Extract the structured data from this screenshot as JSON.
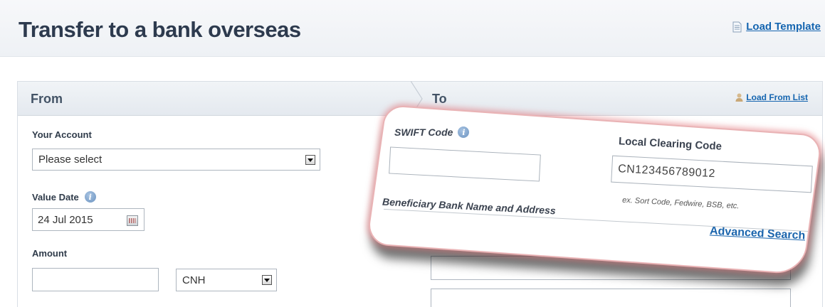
{
  "page": {
    "title": "Transfer to a bank overseas",
    "load_template_label": "Load Template"
  },
  "from": {
    "title": "From",
    "account_label": "Your Account",
    "account_value": "Please select",
    "value_date_label": "Value Date",
    "value_date": "24 Jul 2015",
    "amount_label": "Amount",
    "amount_value": "",
    "currency_value": "CNH"
  },
  "to": {
    "title": "To",
    "load_from_list_label": "Load From List",
    "swift_label": "SWIFT Code",
    "swift_value": "",
    "local_clearing_label": "Local Clearing Code",
    "local_clearing_value": "CN123456789012",
    "local_clearing_hint": "ex. Sort Code, Fedwire, BSB, etc.",
    "bank_label": "Beneficiary Bank Name and Address",
    "advanced_search_label": "Advanced Search"
  },
  "colors": {
    "link": "#1565b0",
    "heading": "#2d3a4e",
    "callout_glow": "#e2787e"
  },
  "icons": {
    "template": "document-icon",
    "list": "person-icon",
    "info": "info-icon",
    "calendar": "calendar-icon"
  }
}
